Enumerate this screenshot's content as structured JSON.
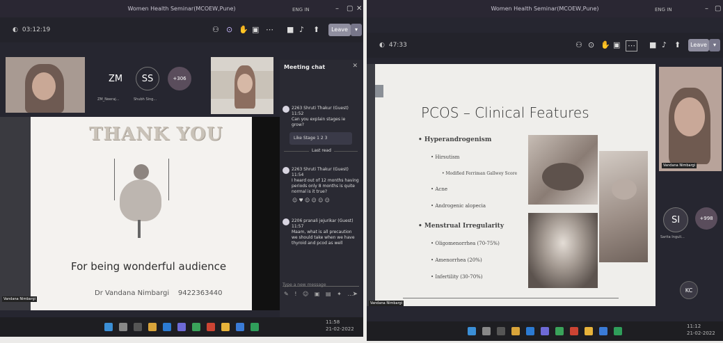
{
  "left": {
    "title": "Women Health Seminar(MCOEW,Pune)",
    "timer": "03:12:19",
    "leave_label": "Leave",
    "participants": [
      {
        "initials": "ZM",
        "name": "ZM_Neeraj...",
        "color": "#3b3944"
      },
      {
        "initials": "SS",
        "name": "Shubh Sing...",
        "color": "#3b3944"
      },
      {
        "initials": "+306",
        "name": "",
        "color": "#5a4d5c"
      }
    ],
    "presenter_name": "Vandana Nimbargi",
    "chat": {
      "header": "Meeting chat",
      "messages": [
        {
          "author": "2263 Shruti Thakur (Guest)",
          "time": "11:52",
          "text": "Can you explain stages ie grow?"
        },
        {
          "author": "",
          "time": "",
          "text": "Like Stage 1 2 3"
        },
        {
          "author": "",
          "time": "",
          "text": "Last read"
        },
        {
          "author": "2263 Shruti Thakur (Guest)",
          "time": "11:54",
          "text": "I heard out of 12 months having periods only 8 months is quite normal is it true?"
        },
        {
          "author": "2206 pranali jejurikar (Guest)",
          "time": "11:57",
          "text": "Maam, what is all precaution we should take when we have thyroid and pcod as well"
        }
      ],
      "input_placeholder": "Type a new message"
    },
    "slide": {
      "heading": "THANK YOU",
      "subheading": "For being wonderful audience",
      "author": "Dr Vandana Nimbargi",
      "phone": "9422363440"
    },
    "tray_time": "11:58",
    "tray_date": "21-02-2022",
    "tray_lang": "ENG IN"
  },
  "right": {
    "title": "Women Health Seminar(MCOEW,Pune)",
    "timer": "47:33",
    "leave_label": "Leave",
    "slide": {
      "title": "PCOS – Clinical Features",
      "items": [
        {
          "text": "Hyperandrogenism",
          "level": 1,
          "bold": true
        },
        {
          "text": "Hirsutism",
          "level": 2,
          "bold": false
        },
        {
          "text": "Modified Ferriman Gallwey Score",
          "level": 3,
          "bold": false
        },
        {
          "text": "Acne",
          "level": 2,
          "bold": false
        },
        {
          "text": "Androgenic alopecia",
          "level": 2,
          "bold": false
        },
        {
          "text": "Menstrual Irregularity",
          "level": 1,
          "bold": true
        },
        {
          "text": "Oligomenorrhea (70-75%)",
          "level": 2,
          "bold": false
        },
        {
          "text": "Amenorrhea (20%)",
          "level": 2,
          "bold": false
        },
        {
          "text": "Infertility (30-70%)",
          "level": 2,
          "bold": false
        }
      ]
    },
    "presenter_name": "Vandana Nimbargi",
    "participants": [
      {
        "initials": "SI",
        "name": "Sarita Inguli...",
        "color": "#3b3944"
      },
      {
        "initials": "+998",
        "name": "",
        "color": "#5a4d5c"
      },
      {
        "initials": "KC",
        "name": "",
        "color": "#3b3944"
      }
    ],
    "tray_time": "11:12",
    "tray_date": "21-02-2022",
    "tray_lang": "ENG IN"
  }
}
